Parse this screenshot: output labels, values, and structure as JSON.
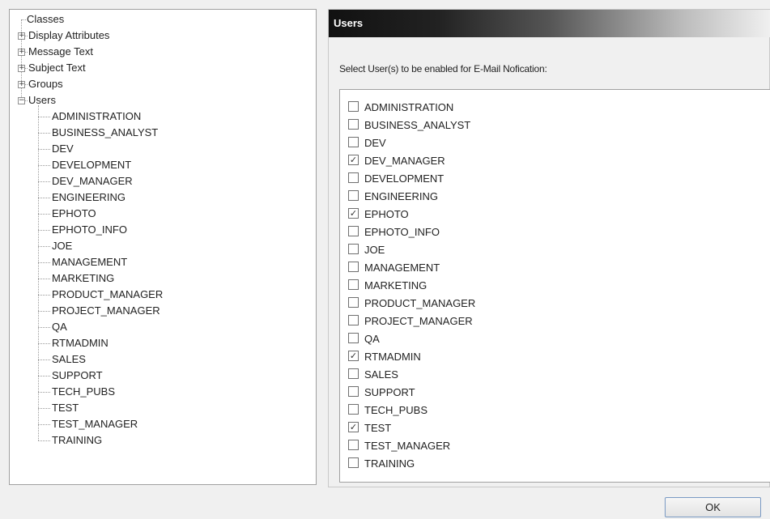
{
  "tree": {
    "root_label": "Classes",
    "top_nodes": [
      {
        "label": "Display Attributes",
        "expander": "+"
      },
      {
        "label": "Message Text",
        "expander": "+"
      },
      {
        "label": "Subject Text",
        "expander": "+"
      },
      {
        "label": "Groups",
        "expander": "+"
      },
      {
        "label": "Users",
        "expander": "−"
      }
    ],
    "user_children": [
      "ADMINISTRATION",
      "BUSINESS_ANALYST",
      "DEV",
      "DEVELOPMENT",
      "DEV_MANAGER",
      "ENGINEERING",
      "EPHOTO",
      "EPHOTO_INFO",
      "JOE",
      "MANAGEMENT",
      "MARKETING",
      "PRODUCT_MANAGER",
      "PROJECT_MANAGER",
      "QA",
      "RTMADMIN",
      "SALES",
      "SUPPORT",
      "TECH_PUBS",
      "TEST",
      "TEST_MANAGER",
      "TRAINING"
    ]
  },
  "panel": {
    "title": "Users",
    "instructions": "Select User(s) to be enabled for E-Mail Nofication:"
  },
  "checklist": [
    {
      "label": "ADMINISTRATION",
      "checked": false
    },
    {
      "label": "BUSINESS_ANALYST",
      "checked": false
    },
    {
      "label": "DEV",
      "checked": false
    },
    {
      "label": "DEV_MANAGER",
      "checked": true
    },
    {
      "label": "DEVELOPMENT",
      "checked": false
    },
    {
      "label": "ENGINEERING",
      "checked": false
    },
    {
      "label": "EPHOTO",
      "checked": true
    },
    {
      "label": "EPHOTO_INFO",
      "checked": false
    },
    {
      "label": "JOE",
      "checked": false
    },
    {
      "label": "MANAGEMENT",
      "checked": false
    },
    {
      "label": "MARKETING",
      "checked": false
    },
    {
      "label": "PRODUCT_MANAGER",
      "checked": false
    },
    {
      "label": "PROJECT_MANAGER",
      "checked": false
    },
    {
      "label": "QA",
      "checked": false
    },
    {
      "label": "RTMADMIN",
      "checked": true
    },
    {
      "label": "SALES",
      "checked": false
    },
    {
      "label": "SUPPORT",
      "checked": false
    },
    {
      "label": "TECH_PUBS",
      "checked": false
    },
    {
      "label": "TEST",
      "checked": true
    },
    {
      "label": "TEST_MANAGER",
      "checked": false
    },
    {
      "label": "TRAINING",
      "checked": false
    }
  ],
  "footer": {
    "ok_label": "OK"
  }
}
